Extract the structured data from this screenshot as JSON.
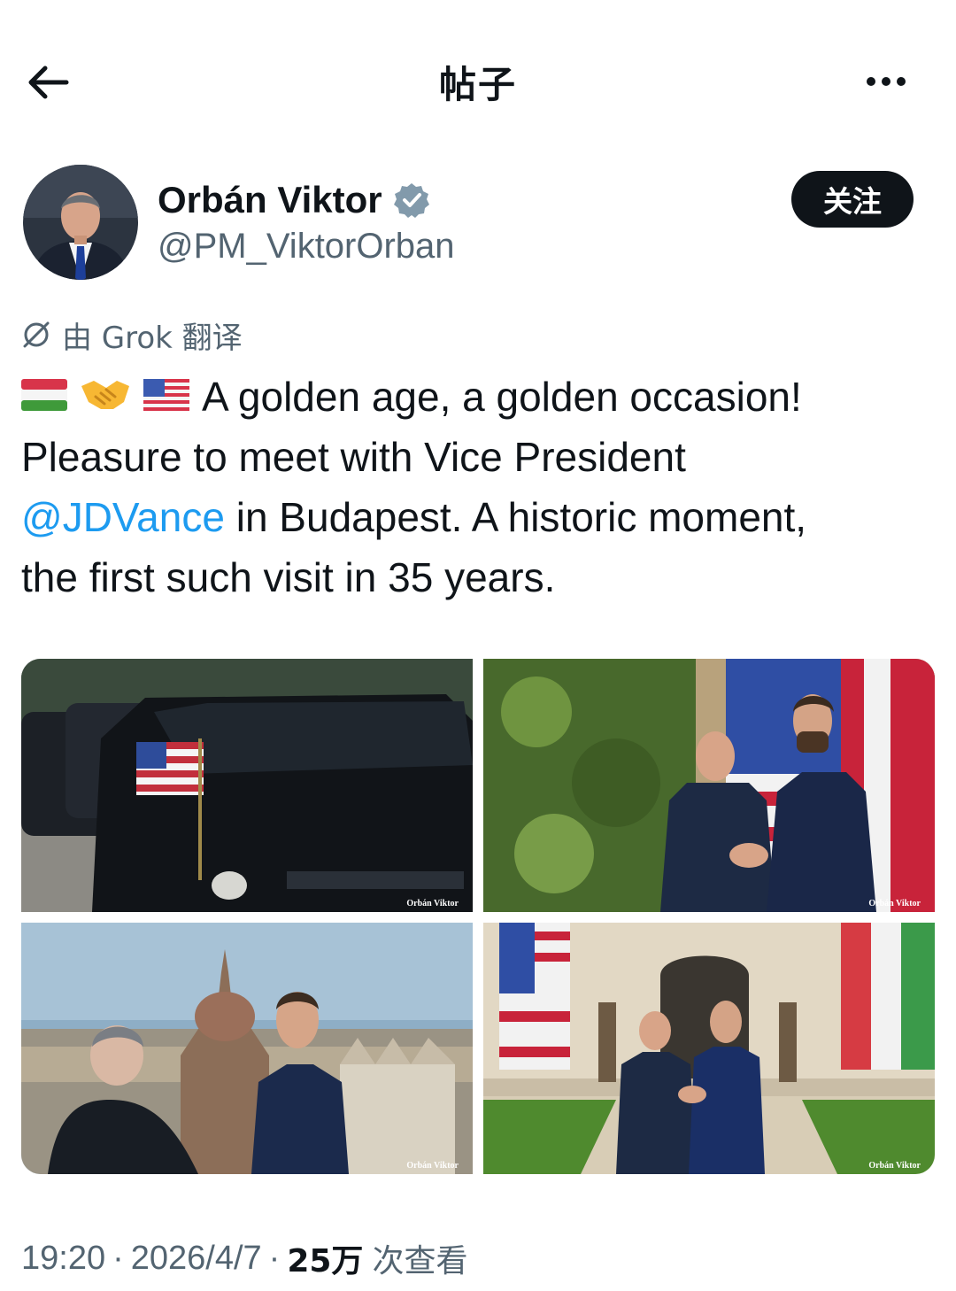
{
  "header": {
    "title": "帖子"
  },
  "author": {
    "display_name": "Orbán Viktor",
    "handle": "@PM_ViktorOrban",
    "follow_label": "关注"
  },
  "translation": {
    "label": "由 Grok 翻译"
  },
  "tweet": {
    "line1": "A golden age, a golden occasion!",
    "line2": "Pleasure to meet with Vice President",
    "mention": "@JDVance",
    "line3_rest": " in Budapest. A historic moment,",
    "line4": "the first such visit in 35 years.",
    "emojis": [
      "hungary-flag",
      "handshake",
      "usa-flag"
    ]
  },
  "media": {
    "photos": [
      {
        "alt": "motorcade-photo",
        "watermark": "Orbán Viktor"
      },
      {
        "alt": "handshake-flags-photo",
        "watermark": "Orbán Viktor"
      },
      {
        "alt": "parliament-view-photo",
        "watermark": "Orbán Viktor"
      },
      {
        "alt": "ceremony-photo",
        "watermark": "Orbán Viktor"
      }
    ]
  },
  "meta": {
    "time": "19:20",
    "date": "2026/4/7",
    "separator": "·",
    "views_count": "25万",
    "views_label": "次查看"
  },
  "colors": {
    "text": "#0f1419",
    "secondary": "#536471",
    "link": "#1d9bf0",
    "verified": "#829aab"
  }
}
